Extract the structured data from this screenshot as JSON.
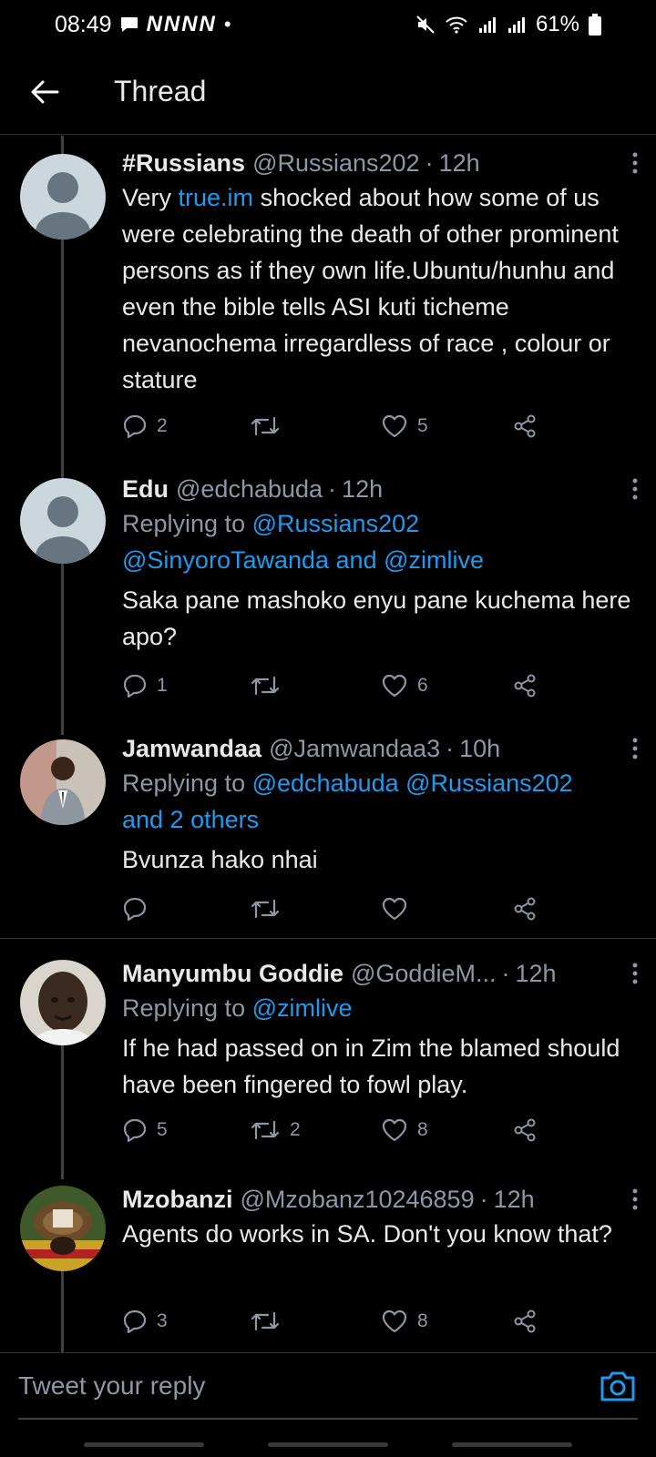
{
  "status_bar": {
    "time": "08:49",
    "notification_letters": "NNNN",
    "battery": "61%"
  },
  "app_bar": {
    "title": "Thread"
  },
  "tweets": [
    {
      "name": "#Russians",
      "handle": "@Russians202",
      "time": "12h",
      "text_before_link": "Very ",
      "link": "true.im",
      "text_after_link": " shocked about how some of us were celebrating the death of other prominent persons as if they own life.Ubuntu/hunhu and even the bible tells ASI kuti ticheme nevanochema irregardless of race , colour or stature",
      "replies": "2",
      "retweets": "",
      "likes": "5"
    },
    {
      "name": "Edu",
      "handle": "@edchabuda",
      "time": "12h",
      "replying_prefix": "Replying to",
      "replying_link1": "@Russians202",
      "replying_link2": "@SinyoroTawanda and @zimlive",
      "text": "Saka pane mashoko enyu pane kuchema here apo?",
      "replies": "1",
      "retweets": "",
      "likes": "6"
    },
    {
      "name": "Jamwandaa",
      "handle": "@Jamwandaa3",
      "time": "10h",
      "replying_prefix": "Replying to",
      "replying_link1": "@edchabuda @Russians202",
      "replying_link2": "and 2 others",
      "text": "Bvunza hako nhai",
      "replies": "",
      "retweets": "",
      "likes": ""
    },
    {
      "name": "Manyumbu Goddie",
      "handle": "@GoddieM...",
      "time": "12h",
      "replying_prefix": "Replying to",
      "replying_link1": "@zimlive",
      "text": "If he had passed on in Zim the blamed should have been fingered to fowl play.",
      "replies": "5",
      "retweets": "2",
      "likes": "8"
    },
    {
      "name": "Mzobanzi",
      "handle": "@Mzobanz10246859",
      "time": "12h",
      "text": "Agents do works in SA. Don't you know that?",
      "replies": "3",
      "retweets": "",
      "likes": "8"
    }
  ],
  "reply_box": {
    "placeholder": "Tweet your reply"
  },
  "colors": {
    "background": "#000000",
    "link": "#1d9bf0",
    "muted": "#8b98a5",
    "text": "#e7e9ea"
  },
  "icons": [
    "back-arrow-icon",
    "more-vertical-icon",
    "reply-icon",
    "retweet-icon",
    "like-icon",
    "share-icon",
    "camera-icon",
    "mute-icon",
    "wifi-icon",
    "signal-icon",
    "battery-icon",
    "message-icon"
  ]
}
